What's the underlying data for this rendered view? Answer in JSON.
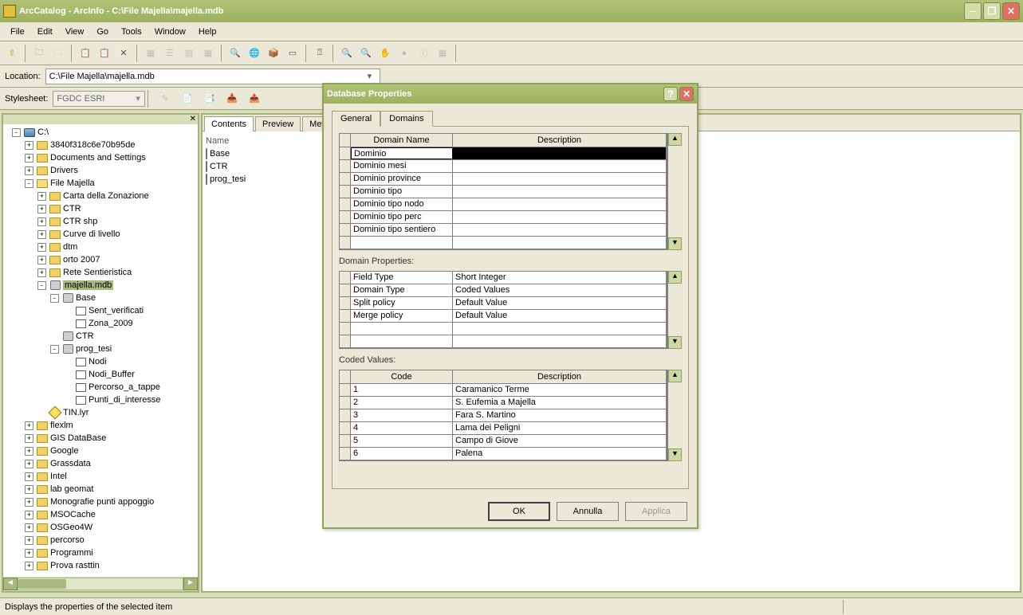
{
  "window": {
    "title": "ArcCatalog - ArcInfo - C:\\File Majella\\majella.mdb"
  },
  "menu": [
    "File",
    "Edit",
    "View",
    "Go",
    "Tools",
    "Window",
    "Help"
  ],
  "location": {
    "label": "Location:",
    "value": "C:\\File Majella\\majella.mdb"
  },
  "stylesheet": {
    "label": "Stylesheet:",
    "value": "FGDC ESRI"
  },
  "tree": [
    {
      "d": 0,
      "exp": "-",
      "ico": "drive",
      "label": "C:\\"
    },
    {
      "d": 1,
      "exp": "+",
      "ico": "folder",
      "label": "3840f318c6e70b95de"
    },
    {
      "d": 1,
      "exp": "+",
      "ico": "folder",
      "label": "Documents and Settings"
    },
    {
      "d": 1,
      "exp": "+",
      "ico": "folder",
      "label": "Drivers"
    },
    {
      "d": 1,
      "exp": "-",
      "ico": "folder-open",
      "label": "File Majella"
    },
    {
      "d": 2,
      "exp": "+",
      "ico": "folder",
      "label": "Carta della Zonazione"
    },
    {
      "d": 2,
      "exp": "+",
      "ico": "folder",
      "label": "CTR"
    },
    {
      "d": 2,
      "exp": "+",
      "ico": "folder",
      "label": "CTR shp"
    },
    {
      "d": 2,
      "exp": "+",
      "ico": "folder",
      "label": "Curve di livello"
    },
    {
      "d": 2,
      "exp": "+",
      "ico": "folder",
      "label": "dtm"
    },
    {
      "d": 2,
      "exp": "+",
      "ico": "folder",
      "label": "orto 2007"
    },
    {
      "d": 2,
      "exp": "+",
      "ico": "folder",
      "label": "Rete Sentieristica"
    },
    {
      "d": 2,
      "exp": "-",
      "ico": "db",
      "label": "majella.mdb",
      "selected": true
    },
    {
      "d": 3,
      "exp": "-",
      "ico": "db",
      "label": "Base"
    },
    {
      "d": 4,
      "exp": " ",
      "ico": "fc",
      "label": "Sent_verificati"
    },
    {
      "d": 4,
      "exp": " ",
      "ico": "fc",
      "label": "Zona_2009"
    },
    {
      "d": 3,
      "exp": " ",
      "ico": "db",
      "label": "CTR"
    },
    {
      "d": 3,
      "exp": "-",
      "ico": "db",
      "label": "prog_tesi"
    },
    {
      "d": 4,
      "exp": " ",
      "ico": "fc",
      "label": "Nodi"
    },
    {
      "d": 4,
      "exp": " ",
      "ico": "fc",
      "label": "Nodi_Buffer"
    },
    {
      "d": 4,
      "exp": " ",
      "ico": "fc",
      "label": "Percorso_a_tappe"
    },
    {
      "d": 4,
      "exp": " ",
      "ico": "fc",
      "label": "Punti_di_interesse"
    },
    {
      "d": 2,
      "exp": " ",
      "ico": "layer",
      "label": "TIN.lyr"
    },
    {
      "d": 1,
      "exp": "+",
      "ico": "folder",
      "label": "flexlm"
    },
    {
      "d": 1,
      "exp": "+",
      "ico": "folder",
      "label": "GIS DataBase"
    },
    {
      "d": 1,
      "exp": "+",
      "ico": "folder",
      "label": "Google"
    },
    {
      "d": 1,
      "exp": "+",
      "ico": "folder",
      "label": "Grassdata"
    },
    {
      "d": 1,
      "exp": "+",
      "ico": "folder",
      "label": "Intel"
    },
    {
      "d": 1,
      "exp": "+",
      "ico": "folder",
      "label": "lab geomat"
    },
    {
      "d": 1,
      "exp": "+",
      "ico": "folder",
      "label": "Monografie punti appoggio"
    },
    {
      "d": 1,
      "exp": "+",
      "ico": "folder",
      "label": "MSOCache"
    },
    {
      "d": 1,
      "exp": "+",
      "ico": "folder",
      "label": "OSGeo4W"
    },
    {
      "d": 1,
      "exp": "+",
      "ico": "folder",
      "label": "percorso"
    },
    {
      "d": 1,
      "exp": "+",
      "ico": "folder",
      "label": "Programmi"
    },
    {
      "d": 1,
      "exp": "+",
      "ico": "folder",
      "label": "Prova rasttin"
    }
  ],
  "content": {
    "tabs": [
      "Contents",
      "Preview",
      "Metadata"
    ],
    "active_tab": 0,
    "colhead": "Name",
    "items": [
      {
        "ico": "db",
        "label": "Base"
      },
      {
        "ico": "db",
        "label": "CTR"
      },
      {
        "ico": "db",
        "label": "prog_tesi"
      }
    ]
  },
  "dialog": {
    "title": "Database Properties",
    "tabs": [
      "General",
      "Domains"
    ],
    "active_tab": 1,
    "domains": {
      "headers": [
        "Domain Name",
        "Description"
      ],
      "rows": [
        {
          "name": "Dominio",
          "desc": "",
          "selected": true
        },
        {
          "name": "Dominio mesi",
          "desc": ""
        },
        {
          "name": "Dominio province",
          "desc": ""
        },
        {
          "name": "Dominio tipo",
          "desc": ""
        },
        {
          "name": "Dominio tipo nodo",
          "desc": ""
        },
        {
          "name": "Dominio tipo perc",
          "desc": ""
        },
        {
          "name": "Dominio tipo sentiero",
          "desc": ""
        },
        {
          "name": "",
          "desc": ""
        }
      ]
    },
    "props": {
      "title": "Domain Properties:",
      "rows": [
        [
          "Field Type",
          "Short Integer"
        ],
        [
          "Domain Type",
          "Coded Values"
        ],
        [
          "Split policy",
          "Default Value"
        ],
        [
          "Merge policy",
          "Default Value"
        ],
        [
          "",
          ""
        ],
        [
          "",
          ""
        ]
      ]
    },
    "coded": {
      "title": "Coded Values:",
      "headers": [
        "Code",
        "Description"
      ],
      "rows": [
        [
          "1",
          "Caramanico Terme"
        ],
        [
          "2",
          "S. Eufemia a Majella"
        ],
        [
          "3",
          "Fara S. Martino"
        ],
        [
          "4",
          "Lama dei Peligni"
        ],
        [
          "5",
          "Campo di Giove"
        ],
        [
          "6",
          "Palena"
        ]
      ]
    },
    "buttons": {
      "ok": "OK",
      "cancel": "Annulla",
      "apply": "Applica"
    }
  },
  "status": "Displays the properties of the selected item"
}
